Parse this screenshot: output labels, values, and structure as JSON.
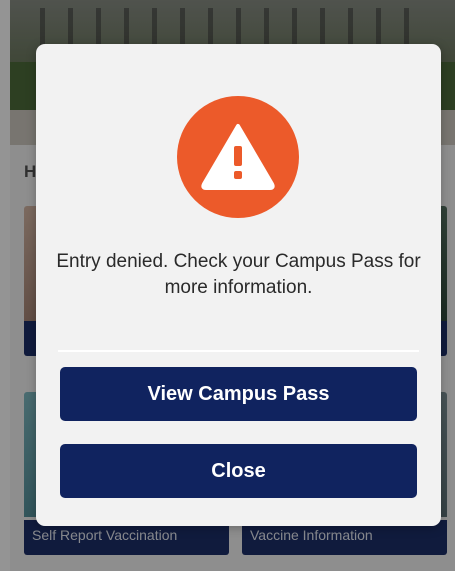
{
  "background": {
    "section_heading": "H",
    "tiles": [
      {
        "label": ""
      },
      {
        "label": ""
      },
      {
        "label": "Self Report Vaccination"
      },
      {
        "label": "Vaccine Information"
      }
    ]
  },
  "dialog": {
    "icon": "warning-triangle-icon",
    "icon_color": "#ec5a2a",
    "message": "Entry denied. Check your Campus Pass for more information.",
    "buttons": {
      "view_pass": "View Campus Pass",
      "close": "Close"
    },
    "button_color": "#10235f"
  }
}
